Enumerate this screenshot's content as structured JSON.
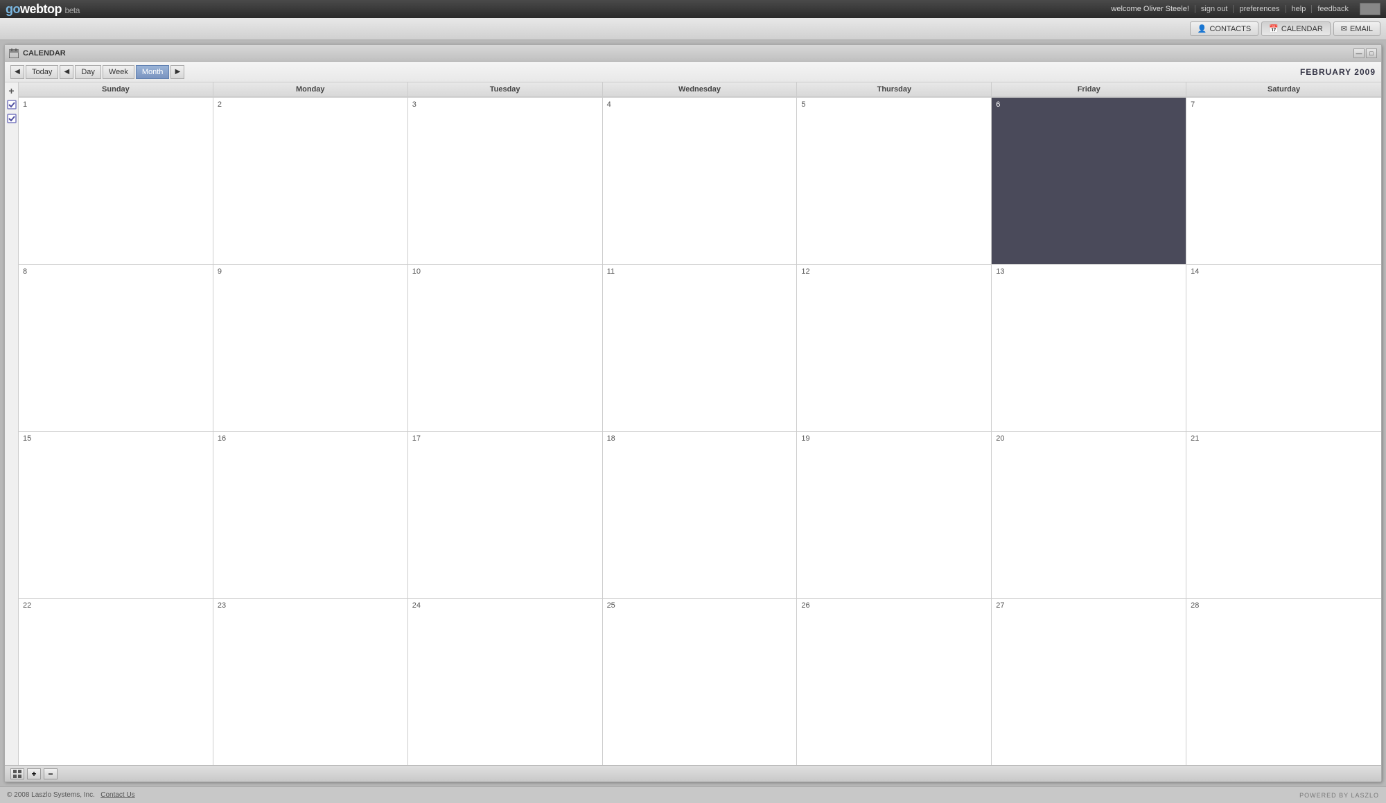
{
  "topbar": {
    "logo_go": "go",
    "logo_webtop": "webtop",
    "logo_beta": "beta",
    "welcome": "welcome Oliver Steele!",
    "sign_out": "sign out",
    "preferences": "preferences",
    "help": "help",
    "feedback": "feedback"
  },
  "appbar": {
    "contacts": "CONTACTS",
    "calendar": "CALENDAR",
    "email": "EMAIL"
  },
  "calendar": {
    "title": "CALENDAR",
    "month_display": "FEBRUARY 2009",
    "toolbar": {
      "today": "Today",
      "day": "Day",
      "week": "Week",
      "month": "Month"
    },
    "days": [
      "Sunday",
      "Monday",
      "Tuesday",
      "Wednesday",
      "Thursday",
      "Friday",
      "Saturday"
    ],
    "weeks": [
      [
        {
          "num": "1",
          "today": false
        },
        {
          "num": "2",
          "today": false
        },
        {
          "num": "3",
          "today": false
        },
        {
          "num": "4",
          "today": false
        },
        {
          "num": "5",
          "today": false
        },
        {
          "num": "6",
          "today": true
        },
        {
          "num": "7",
          "today": false
        }
      ],
      [
        {
          "num": "8",
          "today": false
        },
        {
          "num": "9",
          "today": false
        },
        {
          "num": "10",
          "today": false
        },
        {
          "num": "11",
          "today": false
        },
        {
          "num": "12",
          "today": false
        },
        {
          "num": "13",
          "today": false
        },
        {
          "num": "14",
          "today": false
        }
      ],
      [
        {
          "num": "15",
          "today": false
        },
        {
          "num": "16",
          "today": false
        },
        {
          "num": "17",
          "today": false
        },
        {
          "num": "18",
          "today": false
        },
        {
          "num": "19",
          "today": false
        },
        {
          "num": "20",
          "today": false
        },
        {
          "num": "21",
          "today": false
        }
      ],
      [
        {
          "num": "22",
          "today": false
        },
        {
          "num": "23",
          "today": false
        },
        {
          "num": "24",
          "today": false
        },
        {
          "num": "25",
          "today": false
        },
        {
          "num": "26",
          "today": false
        },
        {
          "num": "27",
          "today": false
        },
        {
          "num": "28",
          "today": false
        }
      ]
    ],
    "window_controls": {
      "minimize": "—",
      "maximize": "□"
    }
  },
  "footer": {
    "copyright": "© 2008 Laszlo Systems, Inc.",
    "contact_us": "Contact Us",
    "powered_by": "POWERED BY LASZLO"
  }
}
